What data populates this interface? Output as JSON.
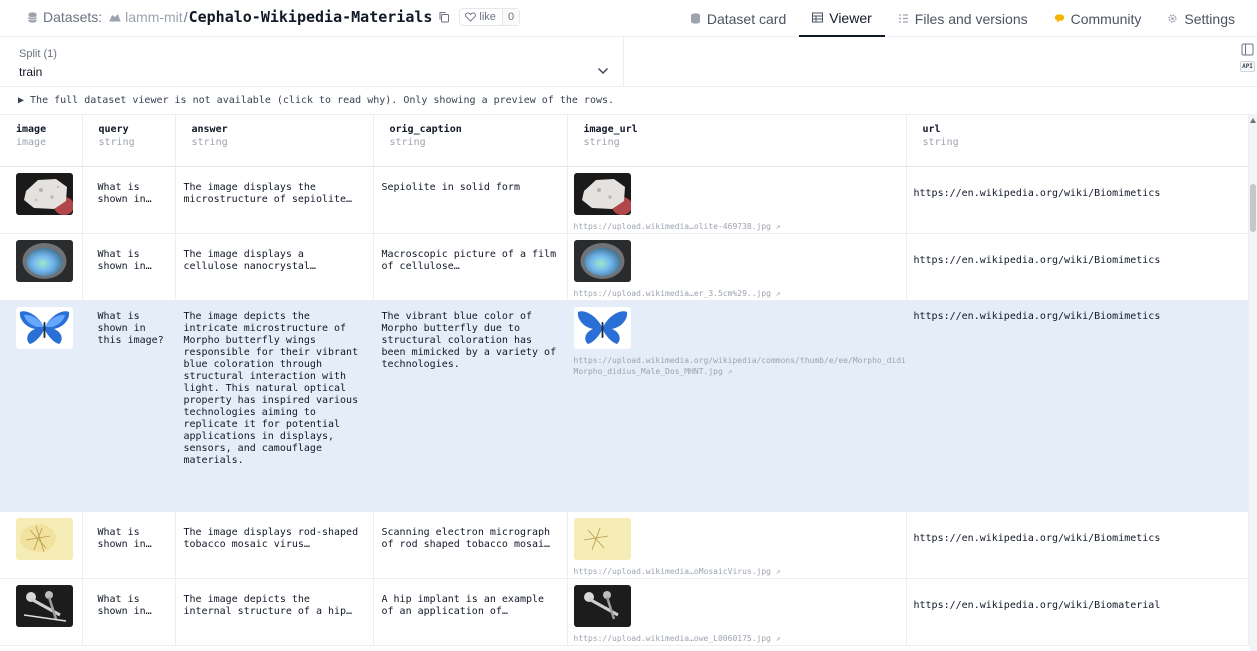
{
  "header": {
    "section_label": "Datasets:",
    "owner": "lamm-mit",
    "separator": "/",
    "repo_name": "Cephalo-Wikipedia-Materials",
    "like_label": "like",
    "like_count": "0",
    "tabs": [
      {
        "label": "Dataset card",
        "icon": "dataset-card-icon"
      },
      {
        "label": "Viewer",
        "icon": "table-icon",
        "active": true
      },
      {
        "label": "Files and versions",
        "icon": "files-icon"
      },
      {
        "label": "Community",
        "icon": "community-icon"
      },
      {
        "label": "Settings",
        "icon": "gear-icon"
      }
    ]
  },
  "split": {
    "label": "Split (1)",
    "value": "train"
  },
  "api_label": "API",
  "notice": "▶ The full dataset viewer is not available (click to read why). Only showing a preview of the rows.",
  "columns": [
    {
      "name": "image",
      "type": "image"
    },
    {
      "name": "query",
      "type": "string"
    },
    {
      "name": "answer",
      "type": "string"
    },
    {
      "name": "orig_caption",
      "type": "string"
    },
    {
      "name": "image_url",
      "type": "string"
    },
    {
      "name": "url",
      "type": "string"
    }
  ],
  "rows": [
    {
      "query": "What is shown in…",
      "answer": "The image displays the microstructure of sepiolite…",
      "caption": "Sepiolite in solid form",
      "image_url": "https://upload.wikimedia…olite-469738.jpg ↗",
      "url": "https://en.wikipedia.org/wiki/Biomimetics"
    },
    {
      "query": "What is shown in…",
      "answer": "The image displays a cellulose nanocrystal…",
      "caption": "Macroscopic picture of a film of cellulose…",
      "image_url": "https://upload.wikimedia…er_3.5cm%29..jpg ↗",
      "url": "https://en.wikipedia.org/wiki/Biomimetics"
    },
    {
      "query": "What is shown in this image?",
      "answer": "The image depicts the intricate microstructure of Morpho butterfly wings responsible for their vibrant blue coloration through structural interaction with light. This natural optical property has inspired various technologies aiming to replicate it for potential applications in displays, sensors, and camouflage materials.",
      "caption": "The vibrant blue color of Morpho butterfly due to structural coloration has been mimicked by a variety of technologies.",
      "image_url": "https://upload.wikimedia.org/wikipedia/commons/thumb/e/ee/Morpho_didius_Male_Dos_MHNT.jpg/220px-Morpho_didius_Male_Dos_MHNT.jpg ↗",
      "url": "https://en.wikipedia.org/wiki/Biomimetics"
    },
    {
      "query": "What is shown in…",
      "answer": "The image displays rod-shaped tobacco mosaic virus…",
      "caption": "Scanning electron micrograph of rod shaped tobacco mosai…",
      "image_url": "https://upload.wikimedia…oMosaicVirus.jpg ↗",
      "url": "https://en.wikipedia.org/wiki/Biomimetics"
    },
    {
      "query": "What is shown in…",
      "answer": "The image depicts the internal structure of a hip…",
      "caption": "A hip implant is an example of an application of…",
      "image_url": "https://upload.wikimedia…owe_L0060175.jpg ↗",
      "url": "https://en.wikipedia.org/wiki/Biomaterial"
    }
  ],
  "colors": {
    "highlight_row": "#e5edf9",
    "text": "#111827",
    "muted": "#9ca3af",
    "like_heart": "#6b7280",
    "community_icon": "#f5b400"
  }
}
